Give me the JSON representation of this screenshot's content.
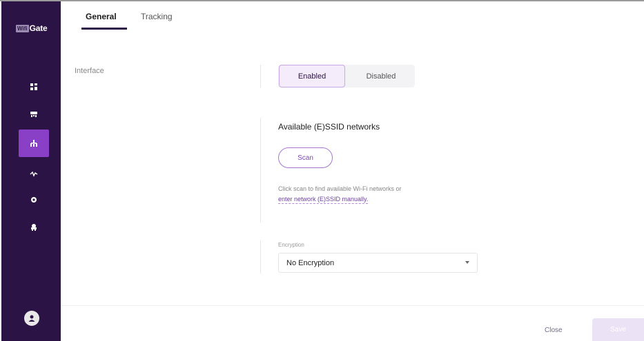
{
  "app": {
    "logo_box": "Wifi",
    "logo_text": "Gate"
  },
  "sidebar": {
    "items": [
      {
        "icon": "dashboard-icon",
        "active": false
      },
      {
        "icon": "router-icon",
        "active": false
      },
      {
        "icon": "network-icon",
        "active": true
      },
      {
        "icon": "activity-icon",
        "active": false
      },
      {
        "icon": "gear-icon",
        "active": false
      },
      {
        "icon": "services-icon",
        "active": false
      }
    ],
    "avatar_icon": "user-icon"
  },
  "tabs": {
    "general": "General",
    "tracking": "Tracking",
    "active": "General"
  },
  "interface": {
    "label": "Interface",
    "enabled_label": "Enabled",
    "disabled_label": "Disabled",
    "selected": "Enabled"
  },
  "networks": {
    "heading": "Available (E)SSID networks",
    "scan_label": "Scan",
    "hint": "Click scan to find available Wi-Fi networks or",
    "manual_link": "enter network (E)SSID manually."
  },
  "encryption": {
    "label": "Encryption",
    "value": "No Encryption"
  },
  "footer": {
    "close_label": "Close",
    "save_label": "Save"
  },
  "colors": {
    "sidebar_bg": "#2c1345",
    "accent": "#8a3fc7",
    "accent_light": "#f4ecfb"
  }
}
